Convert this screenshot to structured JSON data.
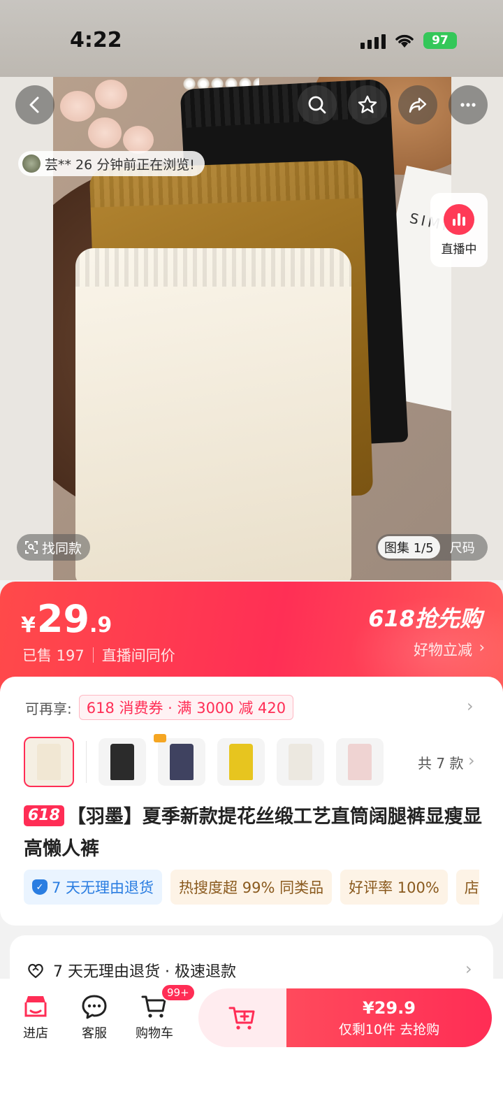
{
  "status": {
    "time": "4:22",
    "battery": "97"
  },
  "hero": {
    "viewer_notice": "芸** 26 分钟前正在浏览!",
    "live_label": "直播中",
    "find_similar": "找同款",
    "gallery_counter": "图集 1/5",
    "size_label": "尺码",
    "photo_text": "SIMPLE T"
  },
  "price": {
    "currency": "¥",
    "integer": "29",
    "decimal": ".9",
    "sold": "已售 197",
    "live_same_price": "直播间同价",
    "promo_title": "618抢先购",
    "promo_sub": "好物立减"
  },
  "info": {
    "coupon_label": "可再享:",
    "coupon_text": "618 消费券 · 满 3000 减 420",
    "total_styles": "共 7 款",
    "title_badge": "618",
    "title": "【羽墨】夏季新款提花丝缎工艺直筒阔腿裤显瘦显高懒人裤",
    "tags": [
      "7 天无理由退货",
      "热搜度超 99% 同类品",
      "好评率 100%",
      "店"
    ],
    "swatches": [
      "#f1e7d3",
      "#2b2b2b",
      "#3f4260",
      "#e7c51f",
      "#ece8e0",
      "#efd3d2"
    ]
  },
  "returns": {
    "text": "7 天无理由退货 · 极速退款"
  },
  "bottom": {
    "store": "进店",
    "service": "客服",
    "cart": "购物车",
    "cart_badge": "99+",
    "buy_price": "¥29.9",
    "buy_sub": "仅剩10件  去抢购"
  },
  "colors": {
    "accent": "#ff2d55",
    "promo_gradient_start": "#ff4a4a"
  }
}
